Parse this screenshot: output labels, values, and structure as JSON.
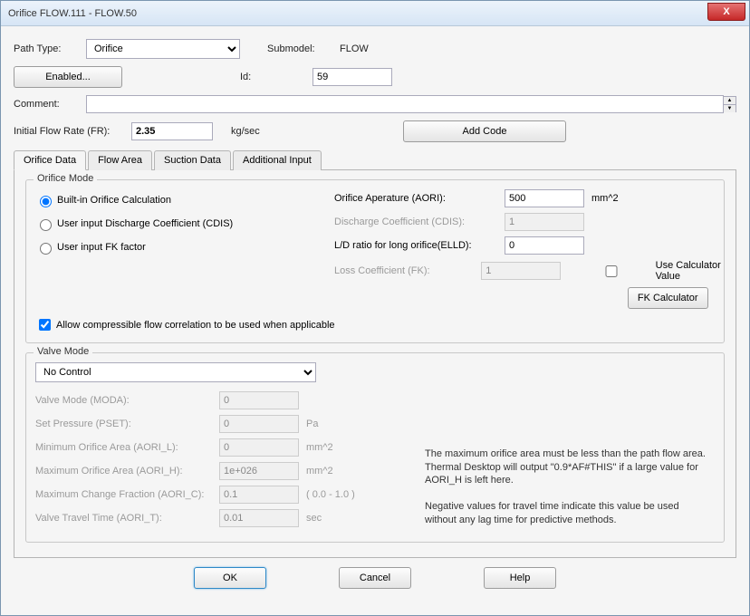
{
  "titlebar": {
    "title": "Orifice FLOW.111 - FLOW.50",
    "close": "X"
  },
  "header": {
    "path_type_label": "Path Type:",
    "path_type_value": "Orifice",
    "submodel_label": "Submodel:",
    "submodel_value": "FLOW",
    "enabled_btn": "Enabled...",
    "id_label": "Id:",
    "id_value": "59",
    "comment_label": "Comment:",
    "comment_value": "",
    "ifr_label": "Initial Flow Rate (FR):",
    "ifr_value": "2.35",
    "ifr_unit": "kg/sec",
    "add_code_btn": "Add Code"
  },
  "tabs": {
    "orifice_data": "Orifice Data",
    "flow_area": "Flow Area",
    "suction_data": "Suction Data",
    "additional_input": "Additional Input"
  },
  "orifice_mode": {
    "legend": "Orifice Mode",
    "r_builtin": "Built-in Orifice Calculation",
    "r_cds": "User input Discharge Coefficient (CDIS)",
    "r_fk": "User input FK factor",
    "aori_label": "Orifice Aperature (AORI):",
    "aori_value": "500",
    "aori_unit": "mm^2",
    "cdis_label": "Discharge Coefficient (CDIS):",
    "cdis_value": "1",
    "elld_label": "L/D ratio for long orifice(ELLD):",
    "elld_value": "0",
    "fk_label": "Loss Coefficient (FK):",
    "fk_value": "1",
    "use_calc_label": "Use Calculator Value",
    "fk_calc_btn": "FK Calculator",
    "compressible_label": "Allow compressible flow correlation to be used when applicable"
  },
  "valve_mode": {
    "legend": "Valve Mode",
    "select_value": "No Control",
    "moda_label": "Valve Mode (MODA):",
    "moda_value": "0",
    "pset_label": "Set Pressure (PSET):",
    "pset_value": "0",
    "pset_unit": "Pa",
    "aori_l_label": "Minimum Orifice Area (AORI_L):",
    "aori_l_value": "0",
    "aori_l_unit": "mm^2",
    "aori_h_label": "Maximum Orifice Area (AORI_H):",
    "aori_h_value": "1e+026",
    "aori_h_unit": "mm^2",
    "aori_c_label": "Maximum Change Fraction (AORI_C):",
    "aori_c_value": "0.1",
    "aori_c_hint": "( 0.0 - 1.0 )",
    "aori_t_label": "Valve Travel Time (AORI_T):",
    "aori_t_value": "0.01",
    "aori_t_unit": "sec",
    "help1": "The maximum orifice area must be less than the path flow area.  Thermal Desktop will output \"0.9*AF#THIS\" if a large value for AORI_H is left here.",
    "help2": "Negative values for travel time indicate this value be used without any lag time for predictive methods."
  },
  "footer": {
    "ok": "OK",
    "cancel": "Cancel",
    "help": "Help"
  }
}
